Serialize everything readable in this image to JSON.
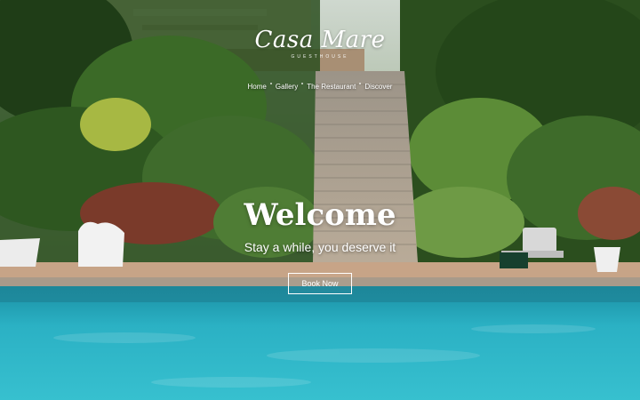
{
  "brand": {
    "name": "Casa Mare",
    "subtitle": "GUESTHOUSE"
  },
  "nav": {
    "items": [
      "Home",
      "Gallery",
      "The Restaurant",
      "Discover"
    ]
  },
  "hero": {
    "title": "Welcome",
    "tagline": "Stay a while, you deserve it",
    "button_label": "Book Now"
  },
  "colors": {
    "pool": "#2fb3c4",
    "foliage": "#2f5a22",
    "terrace": "#c9a68a",
    "text": "#ffffff"
  }
}
